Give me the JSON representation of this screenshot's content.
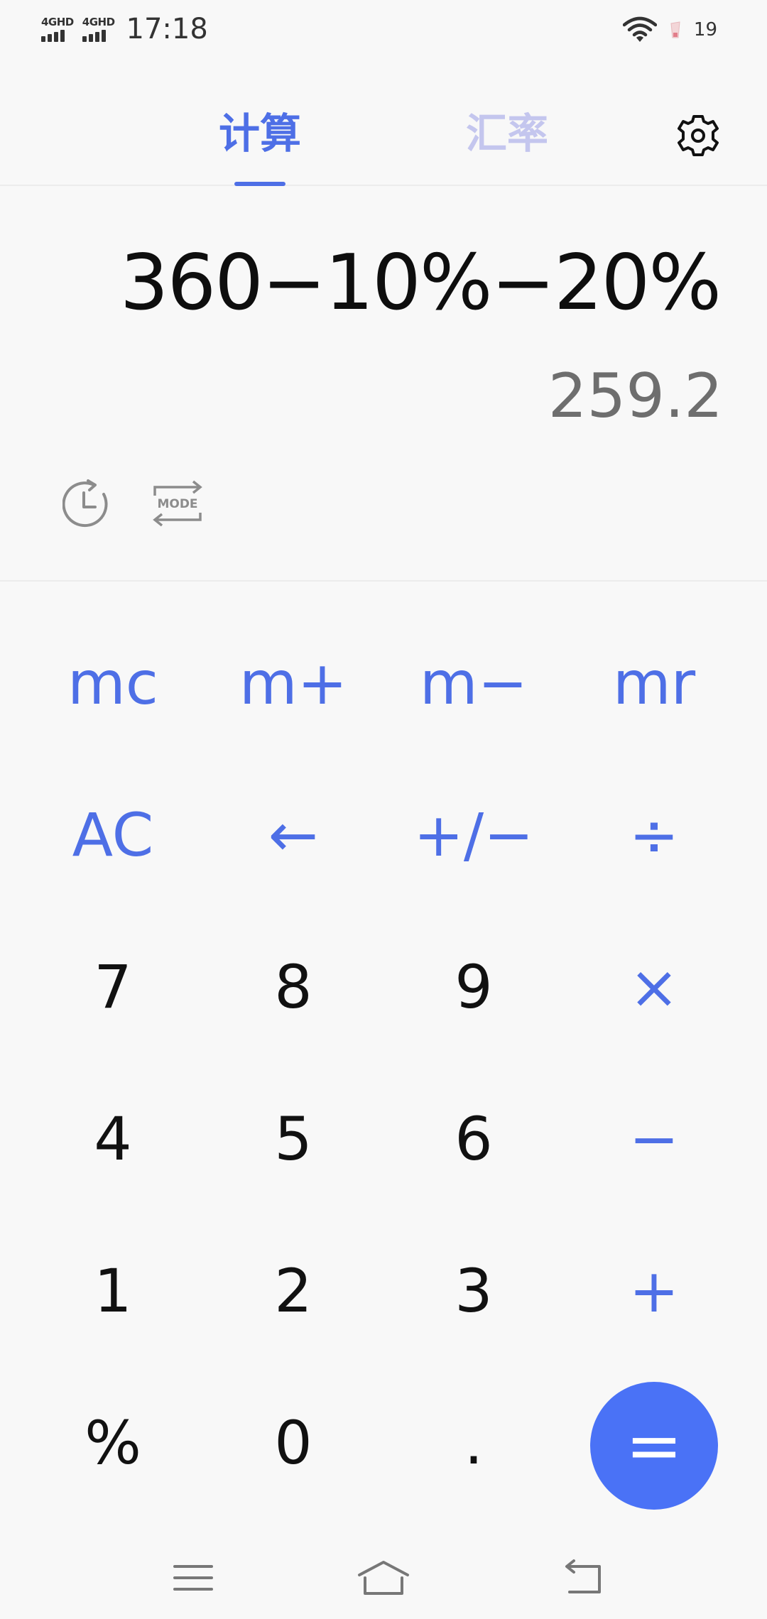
{
  "status_bar": {
    "signal1_label": "4GHD",
    "signal2_label": "4GHD",
    "time": "17:18",
    "battery_level": "19"
  },
  "tabs": {
    "calculator": "计算",
    "exchange_rate": "汇率",
    "active": "calculator"
  },
  "display": {
    "expression": "360−10%−20%",
    "result": "259.2"
  },
  "tools": {
    "mode_label": "MODE"
  },
  "keys": {
    "mc": "mc",
    "mplus": "m+",
    "mminus": "m−",
    "mr": "mr",
    "ac": "AC",
    "backspace": "←",
    "sign": "+/−",
    "divide": "÷",
    "k7": "7",
    "k8": "8",
    "k9": "9",
    "multiply": "×",
    "k4": "4",
    "k5": "5",
    "k6": "6",
    "minus": "−",
    "k1": "1",
    "k2": "2",
    "k3": "3",
    "plus": "+",
    "percent": "%",
    "k0": "0",
    "dot": ".",
    "equals": "="
  },
  "colors": {
    "accent": "#4e6fe6",
    "equals_bg": "#4a72f6",
    "inactive_tab": "#c4c6ee",
    "background": "#f8f8f8"
  },
  "icons": [
    "gear-icon",
    "history-icon",
    "mode-switch-icon",
    "menu-icon",
    "home-icon",
    "back-icon",
    "wifi-icon",
    "battery-icon"
  ]
}
